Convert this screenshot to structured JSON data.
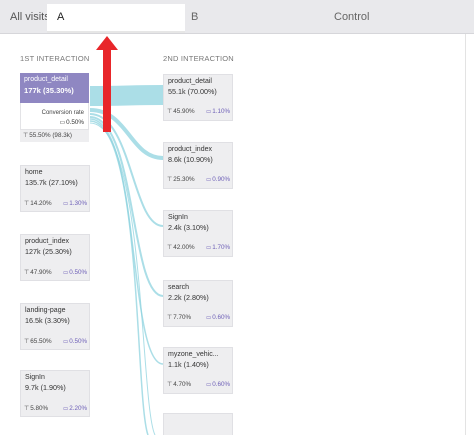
{
  "tabs": {
    "all_visits": "All visits",
    "a": "A",
    "b": "B",
    "control": "Control"
  },
  "columns": {
    "first": "1ST INTERACTION",
    "second": "2ND INTERACTION"
  },
  "first_interaction": [
    {
      "name": "product_detail",
      "value": "177k (35.30%)",
      "conversion_label": "Conversion rate",
      "conversion": "0.50%",
      "left_stat": "55.50% (98.3k)",
      "selected": true
    },
    {
      "name": "home",
      "value": "135.7k (27.10%)",
      "left_stat": "14.20%",
      "right_stat": "1.30%"
    },
    {
      "name": "product_index",
      "value": "127k (25.30%)",
      "left_stat": "47.90%",
      "right_stat": "0.50%"
    },
    {
      "name": "landing-page",
      "value": "16.5k (3.30%)",
      "left_stat": "65.50%",
      "right_stat": "0.50%"
    },
    {
      "name": "SignIn",
      "value": "9.7k (1.90%)",
      "left_stat": "5.80%",
      "right_stat": "2.20%"
    }
  ],
  "second_interaction": [
    {
      "name": "product_detail",
      "value": "55.1k (70.00%)",
      "left_stat": "45.90%",
      "right_stat": "1.10%"
    },
    {
      "name": "product_index",
      "value": "8.6k (10.90%)",
      "left_stat": "25.30%",
      "right_stat": "0.90%"
    },
    {
      "name": "SignIn",
      "value": "2.4k (3.10%)",
      "left_stat": "42.00%",
      "right_stat": "1.70%"
    },
    {
      "name": "search",
      "value": "2.2k (2.80%)",
      "left_stat": "7.70%",
      "right_stat": "0.60%"
    },
    {
      "name": "myzone_vehic...",
      "value": "1.1k (1.40%)",
      "left_stat": "4.70%",
      "right_stat": "0.60%"
    }
  ],
  "icons": {
    "exit": "exit-funnel-icon",
    "conversion": "cart-icon"
  },
  "colors": {
    "selected_node": "#8f87c2",
    "flow": "#8fd3df",
    "arrow": "#e8262a",
    "conversion_text": "#6d5fb7"
  }
}
